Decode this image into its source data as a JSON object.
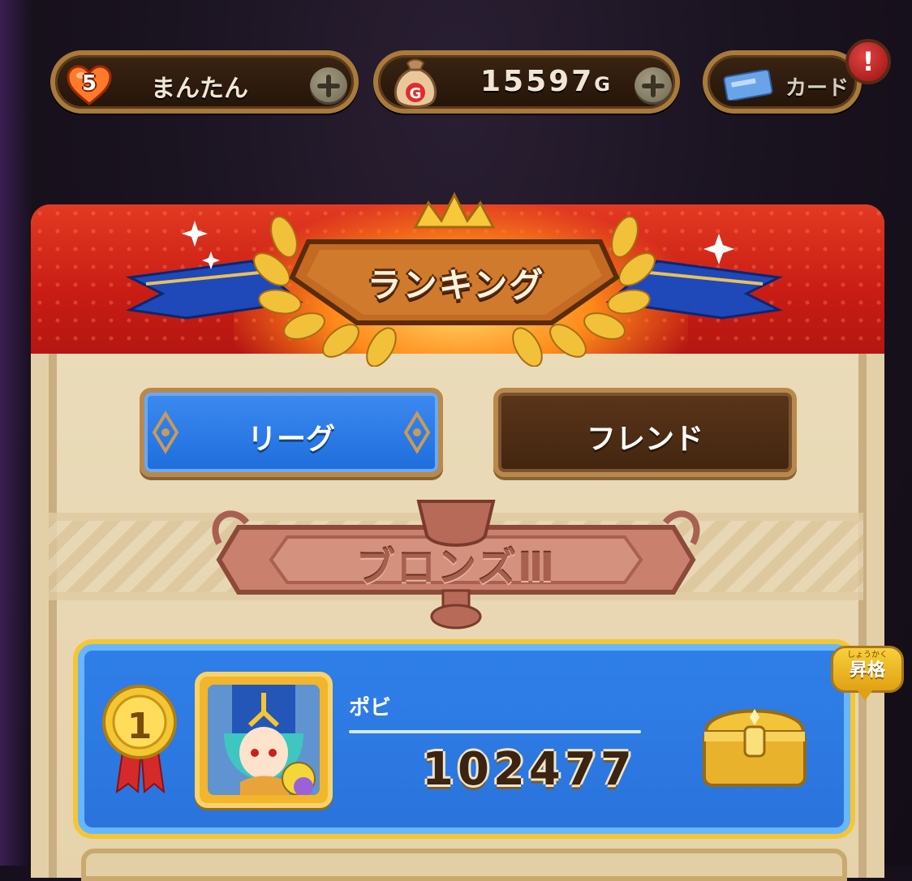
{
  "status_bar": {
    "stamina": {
      "value": "5",
      "label": "まんたん"
    },
    "gold": {
      "amount": "15597",
      "unit": "G"
    },
    "card": {
      "label": "カード",
      "alert": "!"
    }
  },
  "ranking": {
    "title": "ランキング",
    "tabs": [
      {
        "label": "リーグ",
        "active": true
      },
      {
        "label": "フレンド",
        "active": false
      }
    ],
    "league": "ブロンズⅢ",
    "entries": [
      {
        "rank": "1",
        "name": "ポビ",
        "score": "102477",
        "badge_ruby": "しょうかく",
        "badge": "昇格"
      }
    ]
  },
  "colors": {
    "header_red": "#c81c14",
    "tab_active": "#1e6ddc",
    "tab_inactive": "#42250f",
    "row_blue": "#2a74dc",
    "gold": "#f4c633"
  },
  "icons": {
    "stamina": "heart-icon",
    "gold": "money-bag-icon",
    "card": "card-icon",
    "rank": "gold-medal-icon",
    "reward": "treasure-chest-icon",
    "league": "trophy-icon"
  }
}
